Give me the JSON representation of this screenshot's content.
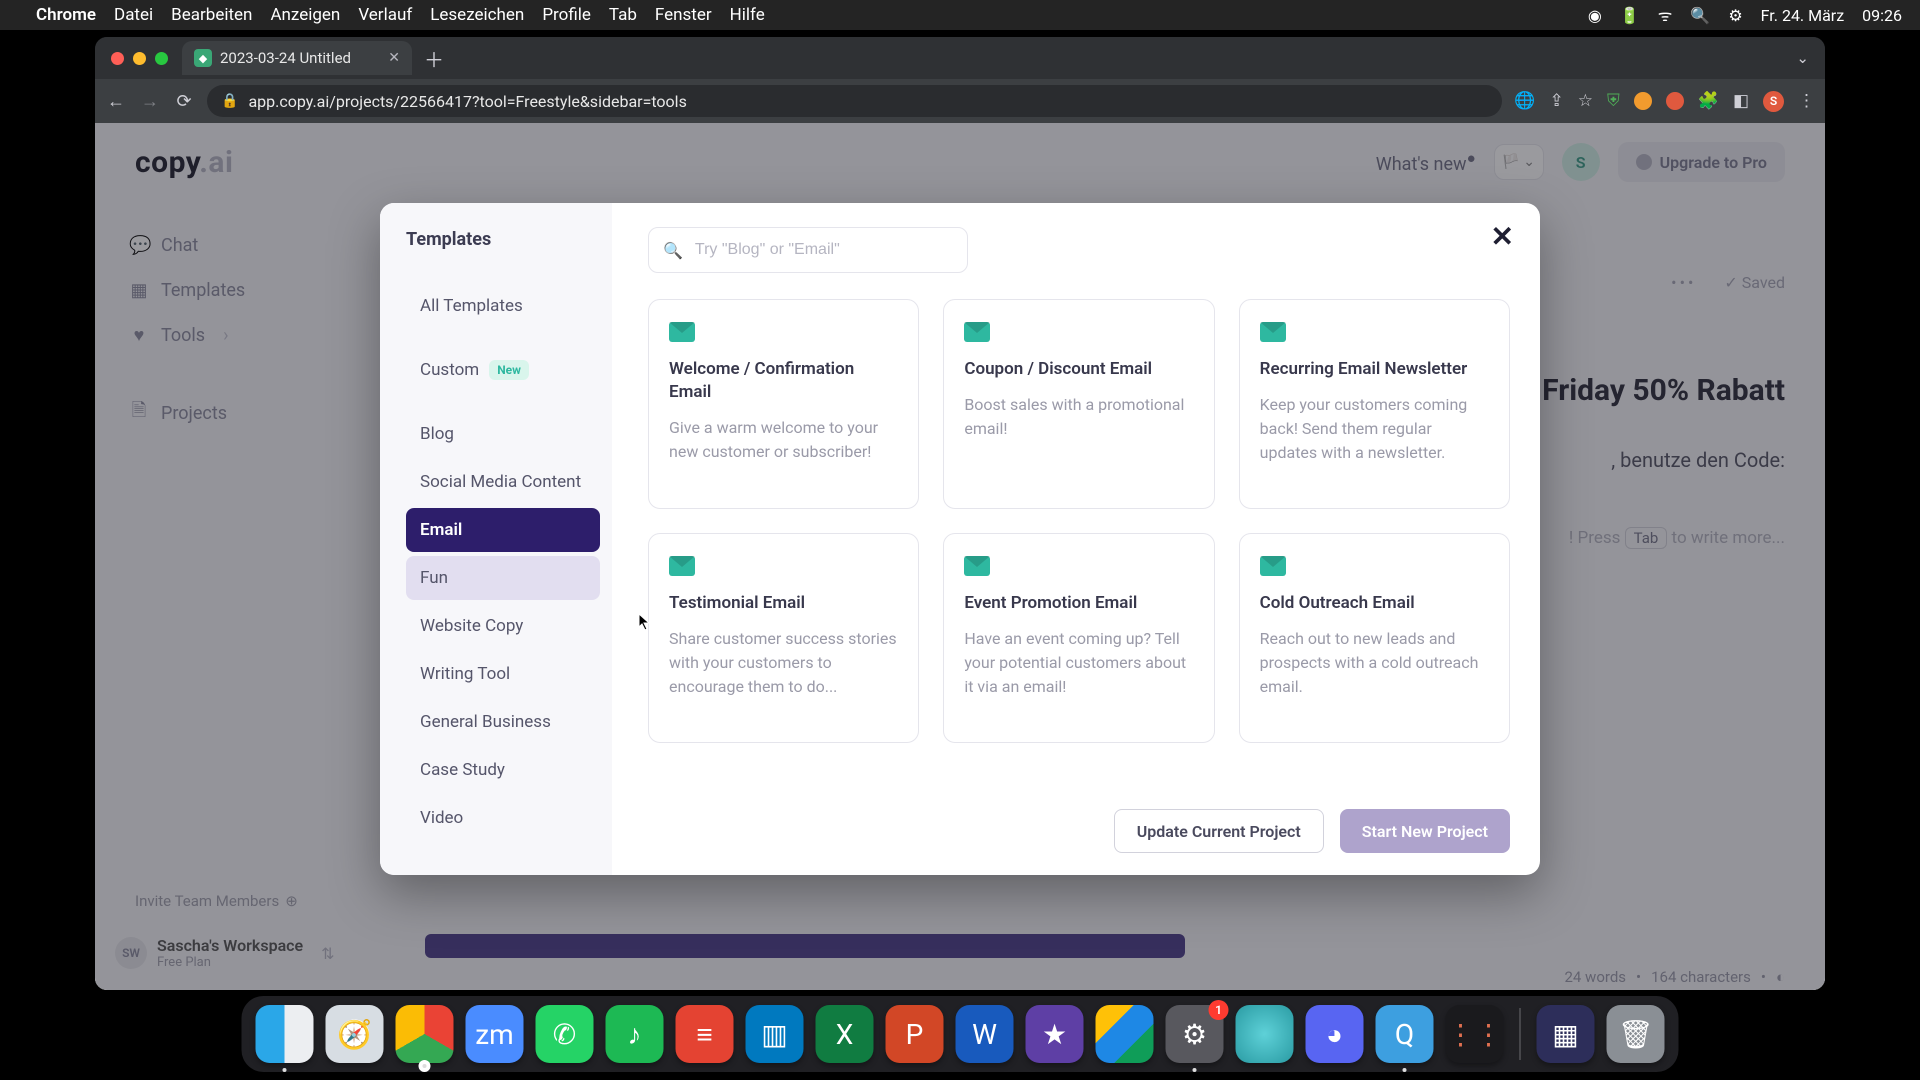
{
  "menubar": {
    "app": "Chrome",
    "items": [
      "Datei",
      "Bearbeiten",
      "Anzeigen",
      "Verlauf",
      "Lesezeichen",
      "Profile",
      "Tab",
      "Fenster",
      "Hilfe"
    ],
    "date": "Fr. 24. März",
    "time": "09:26"
  },
  "browser": {
    "tab_title": "2023-03-24 Untitled",
    "url": "app.copy.ai/projects/22566417?tool=Freestyle&sidebar=tools"
  },
  "app": {
    "logo_a": "copy",
    "logo_b": ".ai",
    "whats_new": "What's new",
    "avatar_initial": "S",
    "upgrade_label": "Upgrade to Pro",
    "nav": {
      "chat": "Chat",
      "templates": "Templates",
      "tools": "Tools",
      "projects": "Projects"
    },
    "invite_label": "Invite Team Members",
    "workspace_name": "Sascha's Workspace",
    "workspace_plan": "Free Plan"
  },
  "doc_peek": {
    "headline": "Friday 50% Rabatt",
    "sub": ", benutze den Code:",
    "hint_pre": "! Press ",
    "hint_key": "Tab",
    "hint_post": " to write more...",
    "saved": "Saved",
    "words": "24 words",
    "chars": "164 characters"
  },
  "modal": {
    "title": "Templates",
    "search_placeholder": "Try \"Blog\" or \"Email\"",
    "categories": [
      {
        "label": "All Templates",
        "sel": false
      },
      {
        "label": "Custom",
        "sel": false,
        "new": true
      },
      {
        "label": "Blog",
        "sel": false
      },
      {
        "label": "Social Media Content",
        "sel": false
      },
      {
        "label": "Email",
        "sel": true
      },
      {
        "label": "Fun",
        "sel": false,
        "hov": true
      },
      {
        "label": "Website Copy",
        "sel": false
      },
      {
        "label": "Writing Tool",
        "sel": false
      },
      {
        "label": "General Business",
        "sel": false
      },
      {
        "label": "Case Study",
        "sel": false
      },
      {
        "label": "Video",
        "sel": false
      }
    ],
    "new_badge": "New",
    "cards": [
      {
        "title": "Welcome / Confirmation Email",
        "desc": "Give a warm welcome to your new customer or subscriber!"
      },
      {
        "title": "Coupon / Discount Email",
        "desc": "Boost sales with a promotional email!"
      },
      {
        "title": "Recurring Email Newsletter",
        "desc": "Keep your customers coming back! Send them regular updates with a newsletter."
      },
      {
        "title": "Testimonial Email",
        "desc": "Share customer success stories with your customers to encourage them to do..."
      },
      {
        "title": "Event Promotion Email",
        "desc": "Have an event coming up? Tell your potential customers about it via an email!"
      },
      {
        "title": "Cold Outreach Email",
        "desc": "Reach out to new leads and prospects with a cold outreach email."
      }
    ],
    "update_btn": "Update Current Project",
    "start_btn": "Start New Project"
  },
  "dock_badge": "1"
}
